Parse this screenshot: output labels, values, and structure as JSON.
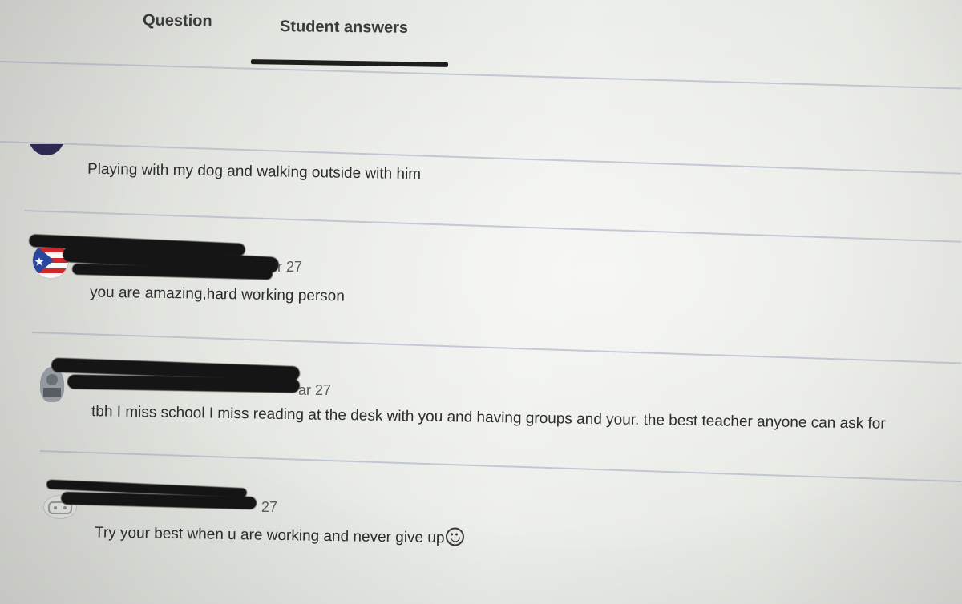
{
  "tabs": {
    "question": "Question",
    "student_answers": "Student answers",
    "active": "student_answers"
  },
  "answers": [
    {
      "date": "",
      "text": "Playing with my dog and walking outside with him"
    },
    {
      "date": "r 27",
      "text": "you are amazing,hard working person"
    },
    {
      "date": "ar 27",
      "text": "tbh I miss school I miss reading at the desk with you and having groups and your. the best teacher anyone can ask for"
    },
    {
      "date": "27",
      "text": "Try your best when u are working and never give up",
      "emoji": "crying-laughing-emoji"
    }
  ],
  "colors": {
    "tab_indicator": "#1d1e1d",
    "divider": "#aab2c4",
    "redaction": "#151515"
  }
}
